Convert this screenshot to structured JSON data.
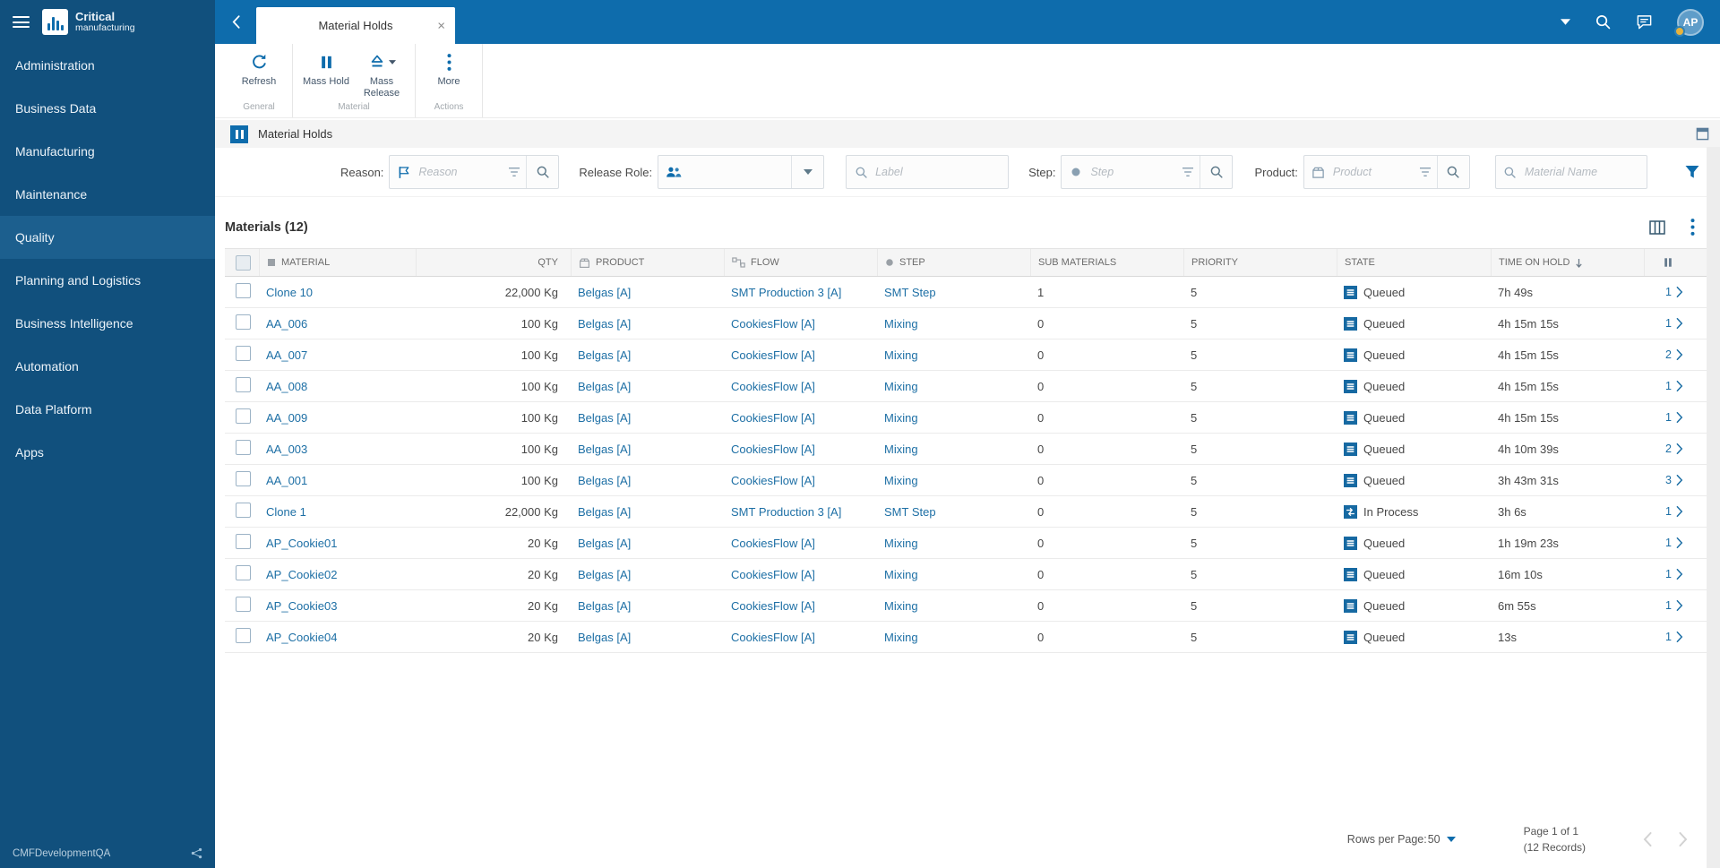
{
  "brand": {
    "line1": "Critical",
    "line2": "manufacturing"
  },
  "topbar": {
    "tab_title": "Material Holds",
    "avatar_initials": "AP"
  },
  "sidebar": {
    "items": [
      "Administration",
      "Business Data",
      "Manufacturing",
      "Maintenance",
      "Quality",
      "Planning and Logistics",
      "Business Intelligence",
      "Automation",
      "Data Platform",
      "Apps"
    ],
    "active_index": 4,
    "environment": "CMFDevelopmentQA"
  },
  "toolbar": {
    "groups": [
      {
        "label": "General",
        "buttons": [
          {
            "label": "Refresh"
          }
        ]
      },
      {
        "label": "Material",
        "buttons": [
          {
            "label": "Mass Hold"
          },
          {
            "label": "Mass Release"
          }
        ]
      },
      {
        "label": "Actions",
        "buttons": [
          {
            "label": "More"
          }
        ]
      }
    ]
  },
  "page": {
    "title": "Material Holds",
    "section_title": "Materials (12)"
  },
  "filters": {
    "reason": {
      "label": "Reason:",
      "placeholder": "Reason"
    },
    "release_role": {
      "label": "Release Role:"
    },
    "label_search": {
      "placeholder": "Label"
    },
    "step": {
      "label": "Step:",
      "placeholder": "Step"
    },
    "product": {
      "label": "Product:",
      "placeholder": "Product"
    },
    "material": {
      "placeholder": "Material Name"
    }
  },
  "table": {
    "columns": [
      "MATERIAL",
      "QTY",
      "PRODUCT",
      "FLOW",
      "STEP",
      "SUB MATERIALS",
      "PRIORITY",
      "STATE",
      "TIME ON HOLD"
    ],
    "rows": [
      {
        "material": "Clone 10",
        "qty": "22,000 Kg",
        "product": "Belgas [A]",
        "flow": "SMT Production 3 [A]",
        "step": "SMT Step",
        "sub_materials": "1",
        "priority": "5",
        "state": "Queued",
        "time_on_hold": "7h 49s",
        "holds": "1"
      },
      {
        "material": "AA_006",
        "qty": "100 Kg",
        "product": "Belgas [A]",
        "flow": "CookiesFlow [A]",
        "step": "Mixing",
        "sub_materials": "0",
        "priority": "5",
        "state": "Queued",
        "time_on_hold": "4h 15m 15s",
        "holds": "1"
      },
      {
        "material": "AA_007",
        "qty": "100 Kg",
        "product": "Belgas [A]",
        "flow": "CookiesFlow [A]",
        "step": "Mixing",
        "sub_materials": "0",
        "priority": "5",
        "state": "Queued",
        "time_on_hold": "4h 15m 15s",
        "holds": "2"
      },
      {
        "material": "AA_008",
        "qty": "100 Kg",
        "product": "Belgas [A]",
        "flow": "CookiesFlow [A]",
        "step": "Mixing",
        "sub_materials": "0",
        "priority": "5",
        "state": "Queued",
        "time_on_hold": "4h 15m 15s",
        "holds": "1"
      },
      {
        "material": "AA_009",
        "qty": "100 Kg",
        "product": "Belgas [A]",
        "flow": "CookiesFlow [A]",
        "step": "Mixing",
        "sub_materials": "0",
        "priority": "5",
        "state": "Queued",
        "time_on_hold": "4h 15m 15s",
        "holds": "1"
      },
      {
        "material": "AA_003",
        "qty": "100 Kg",
        "product": "Belgas [A]",
        "flow": "CookiesFlow [A]",
        "step": "Mixing",
        "sub_materials": "0",
        "priority": "5",
        "state": "Queued",
        "time_on_hold": "4h 10m 39s",
        "holds": "2"
      },
      {
        "material": "AA_001",
        "qty": "100 Kg",
        "product": "Belgas [A]",
        "flow": "CookiesFlow [A]",
        "step": "Mixing",
        "sub_materials": "0",
        "priority": "5",
        "state": "Queued",
        "time_on_hold": "3h 43m 31s",
        "holds": "3"
      },
      {
        "material": "Clone 1",
        "qty": "22,000 Kg",
        "product": "Belgas [A]",
        "flow": "SMT Production 3 [A]",
        "step": "SMT Step",
        "sub_materials": "0",
        "priority": "5",
        "state": "In Process",
        "time_on_hold": "3h 6s",
        "holds": "1"
      },
      {
        "material": "AP_Cookie01",
        "qty": "20 Kg",
        "product": "Belgas [A]",
        "flow": "CookiesFlow [A]",
        "step": "Mixing",
        "sub_materials": "0",
        "priority": "5",
        "state": "Queued",
        "time_on_hold": "1h 19m 23s",
        "holds": "1"
      },
      {
        "material": "AP_Cookie02",
        "qty": "20 Kg",
        "product": "Belgas [A]",
        "flow": "CookiesFlow [A]",
        "step": "Mixing",
        "sub_materials": "0",
        "priority": "5",
        "state": "Queued",
        "time_on_hold": "16m 10s",
        "holds": "1"
      },
      {
        "material": "AP_Cookie03",
        "qty": "20 Kg",
        "product": "Belgas [A]",
        "flow": "CookiesFlow [A]",
        "step": "Mixing",
        "sub_materials": "0",
        "priority": "5",
        "state": "Queued",
        "time_on_hold": "6m 55s",
        "holds": "1"
      },
      {
        "material": "AP_Cookie04",
        "qty": "20 Kg",
        "product": "Belgas [A]",
        "flow": "CookiesFlow [A]",
        "step": "Mixing",
        "sub_materials": "0",
        "priority": "5",
        "state": "Queued",
        "time_on_hold": "13s",
        "holds": "1"
      }
    ]
  },
  "footer": {
    "rows_per_page_label": "Rows per Page:",
    "rows_per_page_value": "50",
    "page_label": "Page 1 of 1",
    "records_label": "(12 Records)"
  }
}
